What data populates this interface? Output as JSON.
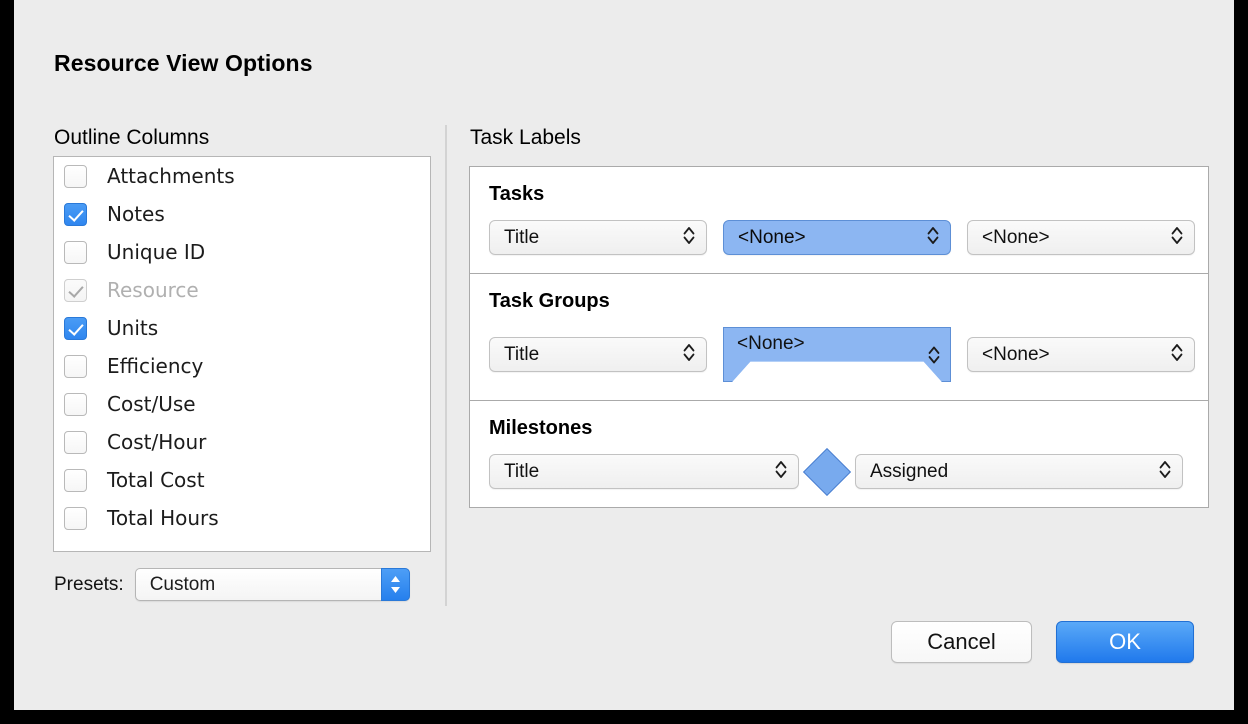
{
  "dialog": {
    "title": "Resource View Options"
  },
  "outline": {
    "heading": "Outline Columns",
    "items": [
      {
        "label": "Attachments",
        "checked": false,
        "disabled": false
      },
      {
        "label": "Notes",
        "checked": true,
        "disabled": false
      },
      {
        "label": "Unique ID",
        "checked": false,
        "disabled": false
      },
      {
        "label": "Resource",
        "checked": true,
        "disabled": true
      },
      {
        "label": "Units",
        "checked": true,
        "disabled": false
      },
      {
        "label": "Efficiency",
        "checked": false,
        "disabled": false
      },
      {
        "label": "Cost/Use",
        "checked": false,
        "disabled": false
      },
      {
        "label": "Cost/Hour",
        "checked": false,
        "disabled": false
      },
      {
        "label": "Total Cost",
        "checked": false,
        "disabled": false
      },
      {
        "label": "Total Hours",
        "checked": false,
        "disabled": false
      }
    ],
    "presets": {
      "label": "Presets:",
      "value": "Custom",
      "stepper_icon": "up-down-chevron-icon"
    }
  },
  "task_labels": {
    "heading": "Task Labels",
    "sections": [
      {
        "title": "Tasks",
        "fields": [
          {
            "value": "Title",
            "style": "normal",
            "icon": "up-down-chevron-icon"
          },
          {
            "value": "<None>",
            "style": "selected",
            "icon": "up-down-chevron-icon"
          },
          {
            "value": "<None>",
            "style": "normal",
            "icon": "up-down-chevron-icon"
          }
        ]
      },
      {
        "title": "Task Groups",
        "fields": [
          {
            "value": "Title",
            "style": "normal",
            "icon": "up-down-chevron-icon"
          },
          {
            "value": "<None>",
            "style": "taskgroup",
            "icon": "up-down-chevron-icon"
          },
          {
            "value": "<None>",
            "style": "normal",
            "icon": "up-down-chevron-icon"
          }
        ]
      },
      {
        "title": "Milestones",
        "marker_icon": "milestone-diamond-icon",
        "fields": [
          {
            "value": "Title",
            "style": "normal",
            "icon": "up-down-chevron-icon"
          },
          {
            "value": "Assigned",
            "style": "normal",
            "icon": "up-down-chevron-icon"
          }
        ]
      }
    ]
  },
  "footer": {
    "cancel_label": "Cancel",
    "ok_label": "OK"
  },
  "colors": {
    "accent_blue": "#2f86ef",
    "selection_blue": "#8cb6f2",
    "window_bg": "#ececec",
    "frame": "#000000"
  }
}
